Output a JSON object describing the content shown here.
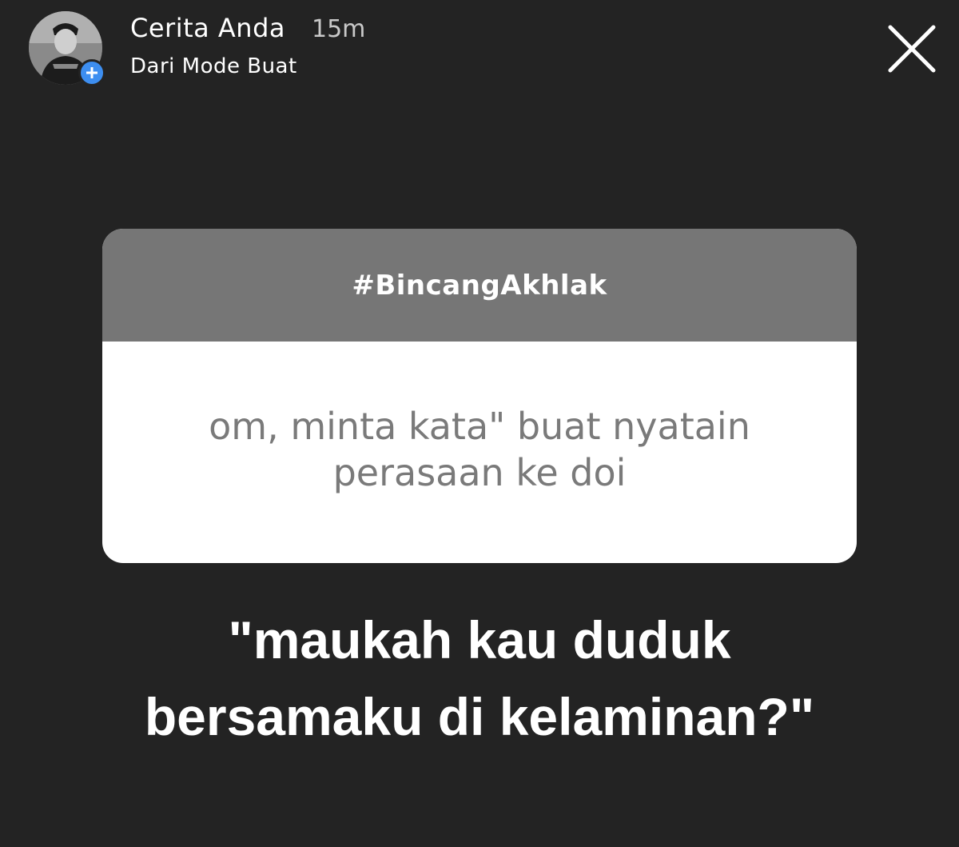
{
  "header": {
    "title": "Cerita Anda",
    "time": "15m",
    "subtitle": "Dari Mode Buat",
    "avatar_icon": "profile-photo",
    "badge_icon": "plus-icon",
    "close_icon": "close-icon"
  },
  "card": {
    "tag": "#BincangAkhlak",
    "question_line1": "om, minta kata\" buat nyatain",
    "question_line2": "perasaan ke doi"
  },
  "answer": {
    "line1": "\"maukah kau duduk",
    "line2": "bersamaku di kelaminan?\""
  },
  "colors": {
    "background": "#232323",
    "card_header": "#767676",
    "badge": "#3d8ef0"
  }
}
